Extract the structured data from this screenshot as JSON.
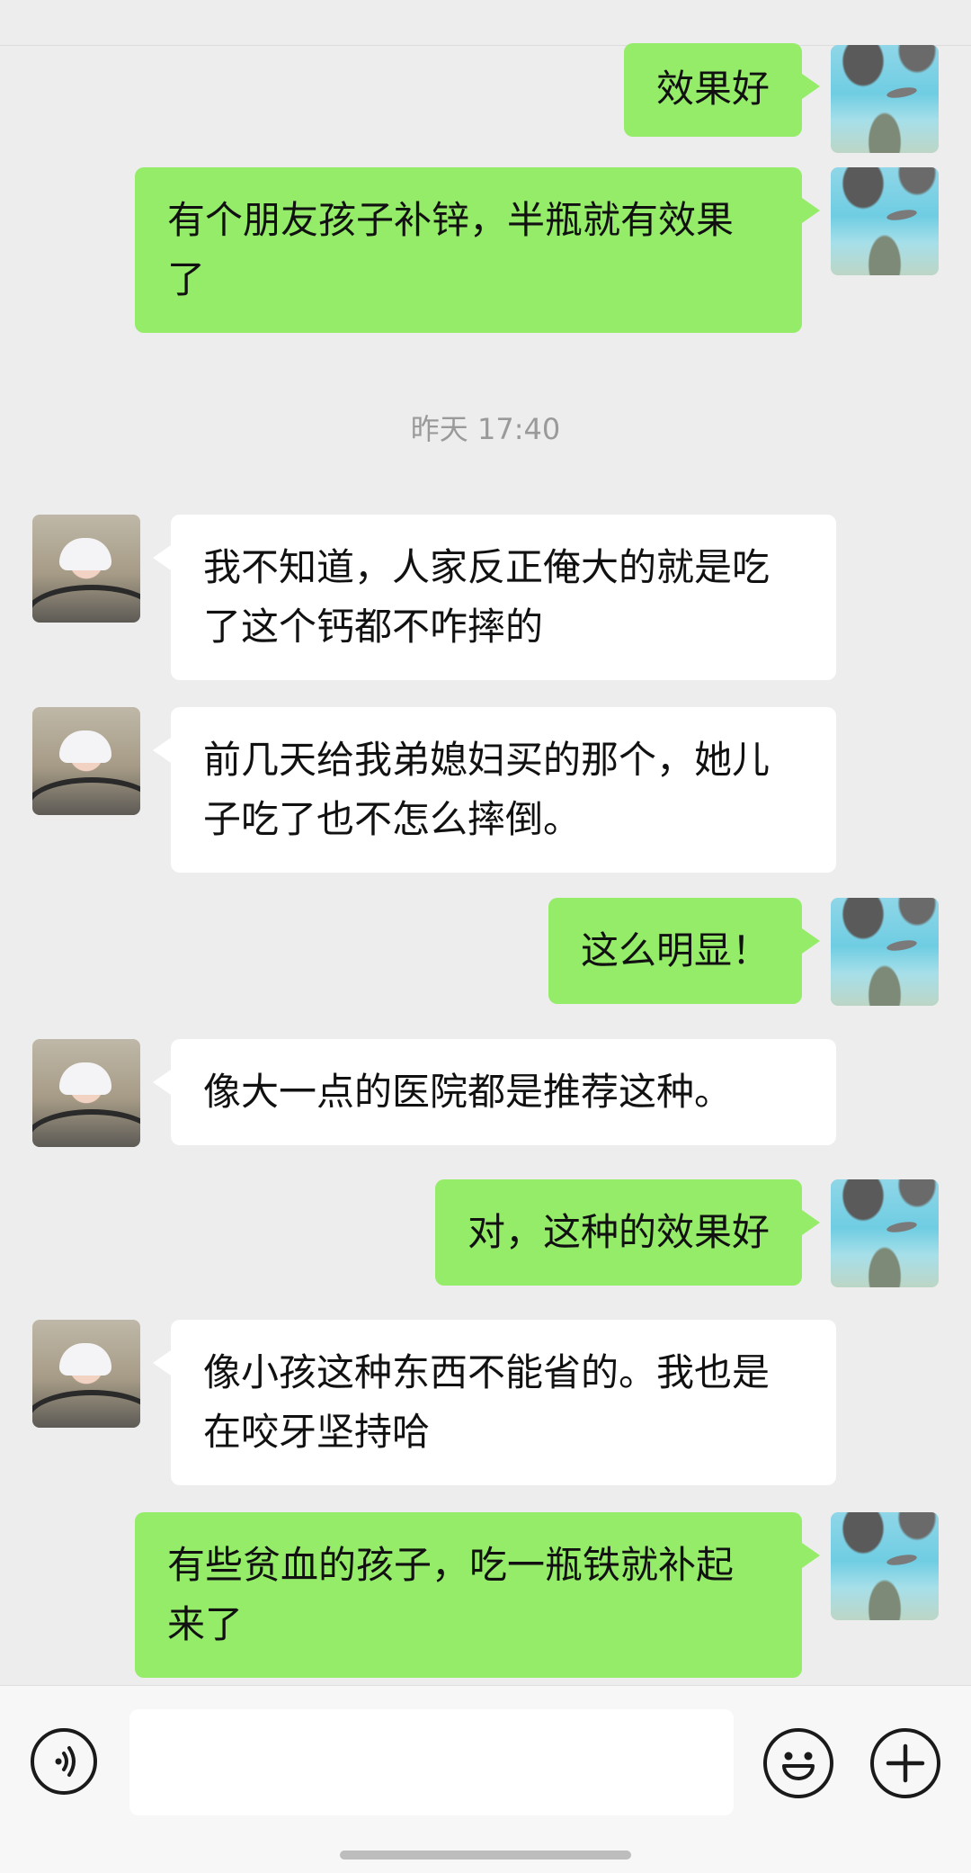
{
  "timestamp": "昨天 17:40",
  "messages": [
    {
      "sender": "me",
      "text": "效果好"
    },
    {
      "sender": "me",
      "text": "有个朋友孩子补锌，半瓶就有效果了"
    },
    {
      "sender": "other",
      "text": "我不知道，人家反正俺大的就是吃了这个钙都不咋摔的"
    },
    {
      "sender": "other",
      "text": "前几天给我弟媳妇买的那个，她儿子吃了也不怎么摔倒。"
    },
    {
      "sender": "me",
      "text": "这么明显！"
    },
    {
      "sender": "other",
      "text": "像大一点的医院都是推荐这种。"
    },
    {
      "sender": "me",
      "text": "对，这种的效果好"
    },
    {
      "sender": "other",
      "text": "像小孩这种东西不能省的。我也是在咬牙坚持哈"
    },
    {
      "sender": "me",
      "text": "有些贫血的孩子，吃一瓶铁就补起来了"
    }
  ],
  "input_bar": {
    "voice_icon": "voice-icon",
    "emoji_icon": "emoji-icon",
    "plus_icon": "plus-icon",
    "message_value": ""
  },
  "colors": {
    "background": "#ededed",
    "my_bubble": "#95ec69",
    "other_bubble": "#ffffff",
    "timestamp_text": "#9a9a9a"
  }
}
